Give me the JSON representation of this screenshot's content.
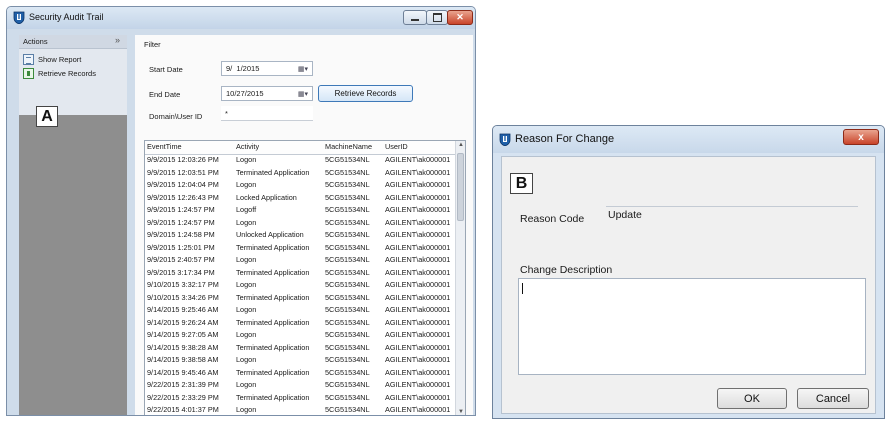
{
  "window_a": {
    "title": "Security Audit Trail",
    "label": "A",
    "actions": {
      "header": "Actions",
      "collapse_glyph": "»",
      "items": [
        {
          "label": "Show Report",
          "icon": "report-icon"
        },
        {
          "label": "Retrieve Records",
          "icon": "retrieve-icon"
        }
      ]
    },
    "filter": {
      "title": "Filter",
      "start_date_label": "Start Date",
      "start_date_value": "9/  1/2015",
      "end_date_label": "End Date",
      "end_date_value": "10/27/2015",
      "user_label": "Domain\\User ID",
      "user_value": "*",
      "retrieve_button": "Retrieve Records"
    },
    "grid": {
      "columns": [
        "EventTime",
        "Activity",
        "MachineName",
        "UserID"
      ],
      "rows": [
        [
          "9/9/2015 12:03:26 PM",
          "Logon",
          "5CG51534NL",
          "AGILENT\\ak000001"
        ],
        [
          "9/9/2015 12:03:51 PM",
          "Terminated Application",
          "5CG51534NL",
          "AGILENT\\ak000001"
        ],
        [
          "9/9/2015 12:04:04 PM",
          "Logon",
          "5CG51534NL",
          "AGILENT\\ak000001"
        ],
        [
          "9/9/2015 12:26:43 PM",
          "Locked Application",
          "5CG51534NL",
          "AGILENT\\ak000001"
        ],
        [
          "9/9/2015 1:24:57 PM",
          "Logoff",
          "5CG51534NL",
          "AGILENT\\ak000001"
        ],
        [
          "9/9/2015 1:24:57 PM",
          "Logon",
          "5CG51534NL",
          "AGILENT\\ak000001"
        ],
        [
          "9/9/2015 1:24:58 PM",
          "Unlocked Application",
          "5CG51534NL",
          "AGILENT\\ak000001"
        ],
        [
          "9/9/2015 1:25:01 PM",
          "Terminated Application",
          "5CG51534NL",
          "AGILENT\\ak000001"
        ],
        [
          "9/9/2015 2:40:57 PM",
          "Logon",
          "5CG51534NL",
          "AGILENT\\ak000001"
        ],
        [
          "9/9/2015 3:17:34 PM",
          "Terminated Application",
          "5CG51534NL",
          "AGILENT\\ak000001"
        ],
        [
          "9/10/2015 3:32:17 PM",
          "Logon",
          "5CG51534NL",
          "AGILENT\\ak000001"
        ],
        [
          "9/10/2015 3:34:26 PM",
          "Terminated Application",
          "5CG51534NL",
          "AGILENT\\ak000001"
        ],
        [
          "9/14/2015 9:25:46 AM",
          "Logon",
          "5CG51534NL",
          "AGILENT\\ak000001"
        ],
        [
          "9/14/2015 9:26:24 AM",
          "Terminated Application",
          "5CG51534NL",
          "AGILENT\\ak000001"
        ],
        [
          "9/14/2015 9:27:05 AM",
          "Logon",
          "5CG51534NL",
          "AGILENT\\ak000001"
        ],
        [
          "9/14/2015 9:38:28 AM",
          "Terminated Application",
          "5CG51534NL",
          "AGILENT\\ak000001"
        ],
        [
          "9/14/2015 9:38:58 AM",
          "Logon",
          "5CG51534NL",
          "AGILENT\\ak000001"
        ],
        [
          "9/14/2015 9:45:46 AM",
          "Terminated Application",
          "5CG51534NL",
          "AGILENT\\ak000001"
        ],
        [
          "9/22/2015 2:31:39 PM",
          "Logon",
          "5CG51534NL",
          "AGILENT\\ak000001"
        ],
        [
          "9/22/2015 2:33:29 PM",
          "Terminated Application",
          "5CG51534NL",
          "AGILENT\\ak000001"
        ],
        [
          "9/22/2015 4:01:37 PM",
          "Logon",
          "5CG51534NL",
          "AGILENT\\ak000001"
        ]
      ]
    }
  },
  "window_b": {
    "title": "Reason For Change",
    "label": "B",
    "close_glyph": "x",
    "reason_code_label": "Reason Code",
    "reason_code_value": "Update",
    "change_description_label": "Change Description",
    "change_description_value": "",
    "ok_button": "OK",
    "cancel_button": "Cancel"
  },
  "colors": {
    "window_frame": "#cfdcea",
    "sidebar_gray": "#8e8e8e",
    "button_border": "#3e79b8",
    "close_red": "#c9442a"
  }
}
